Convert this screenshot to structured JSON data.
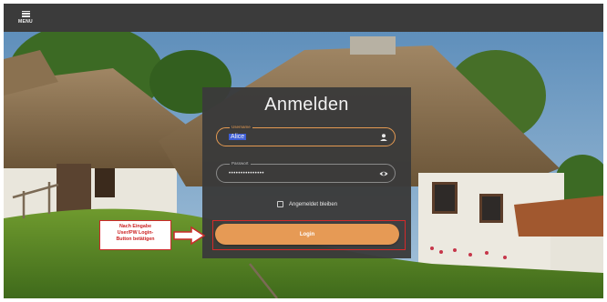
{
  "topbar": {
    "menu_label": "MENU"
  },
  "login": {
    "title": "Anmelden",
    "username": {
      "label": "Username",
      "value": "Alice"
    },
    "password": {
      "label": "Passwort",
      "value": "•••••••••••••••"
    },
    "remember_label": "Angemeldet bleiben",
    "login_button": "Login"
  },
  "annotation": {
    "lines": [
      "Nach Eingabe",
      "User/PW Login-",
      "Button betätigen"
    ]
  },
  "colors": {
    "accent": "#e69a55",
    "highlight": "#d42a2a",
    "card": "#3a3a3a",
    "topbar": "#3b3b3b"
  }
}
